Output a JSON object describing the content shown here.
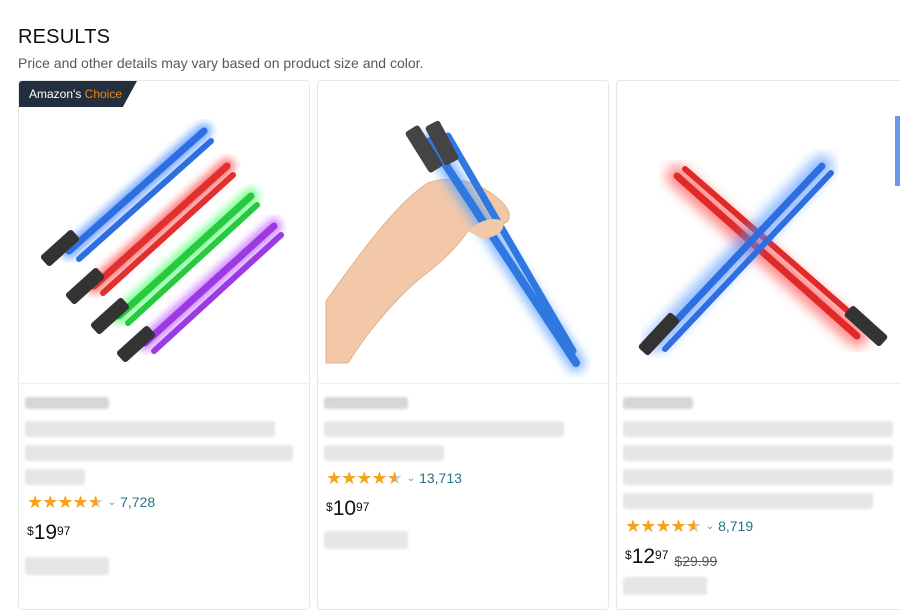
{
  "header": {
    "title": "RESULTS",
    "subtitle": "Price and other details may vary based on product size and color."
  },
  "colors": {
    "star": "#f4a41c",
    "rating_link": "#2a7385",
    "badge_bg": "#232f3e",
    "badge_accent": "#f08804"
  },
  "products": [
    {
      "badge": {
        "prefix": "Amazon's",
        "accent": "Choice"
      },
      "image_icon": "lightsaber-chopsticks-four-colors",
      "rating_stars": 4.5,
      "rating_count": "7,728",
      "price": {
        "currency": "$",
        "whole": "19",
        "fraction": "97"
      }
    },
    {
      "image_icon": "hand-holding-blue-lightsaber-chopsticks",
      "rating_stars": 4.5,
      "rating_count": "13,713",
      "price": {
        "currency": "$",
        "whole": "10",
        "fraction": "97"
      }
    },
    {
      "image_icon": "crossed-red-blue-lightsaber-chopsticks",
      "rating_stars": 4.5,
      "rating_count": "8,719",
      "price": {
        "currency": "$",
        "whole": "12",
        "fraction": "97",
        "list_price": "$29.99"
      }
    }
  ]
}
